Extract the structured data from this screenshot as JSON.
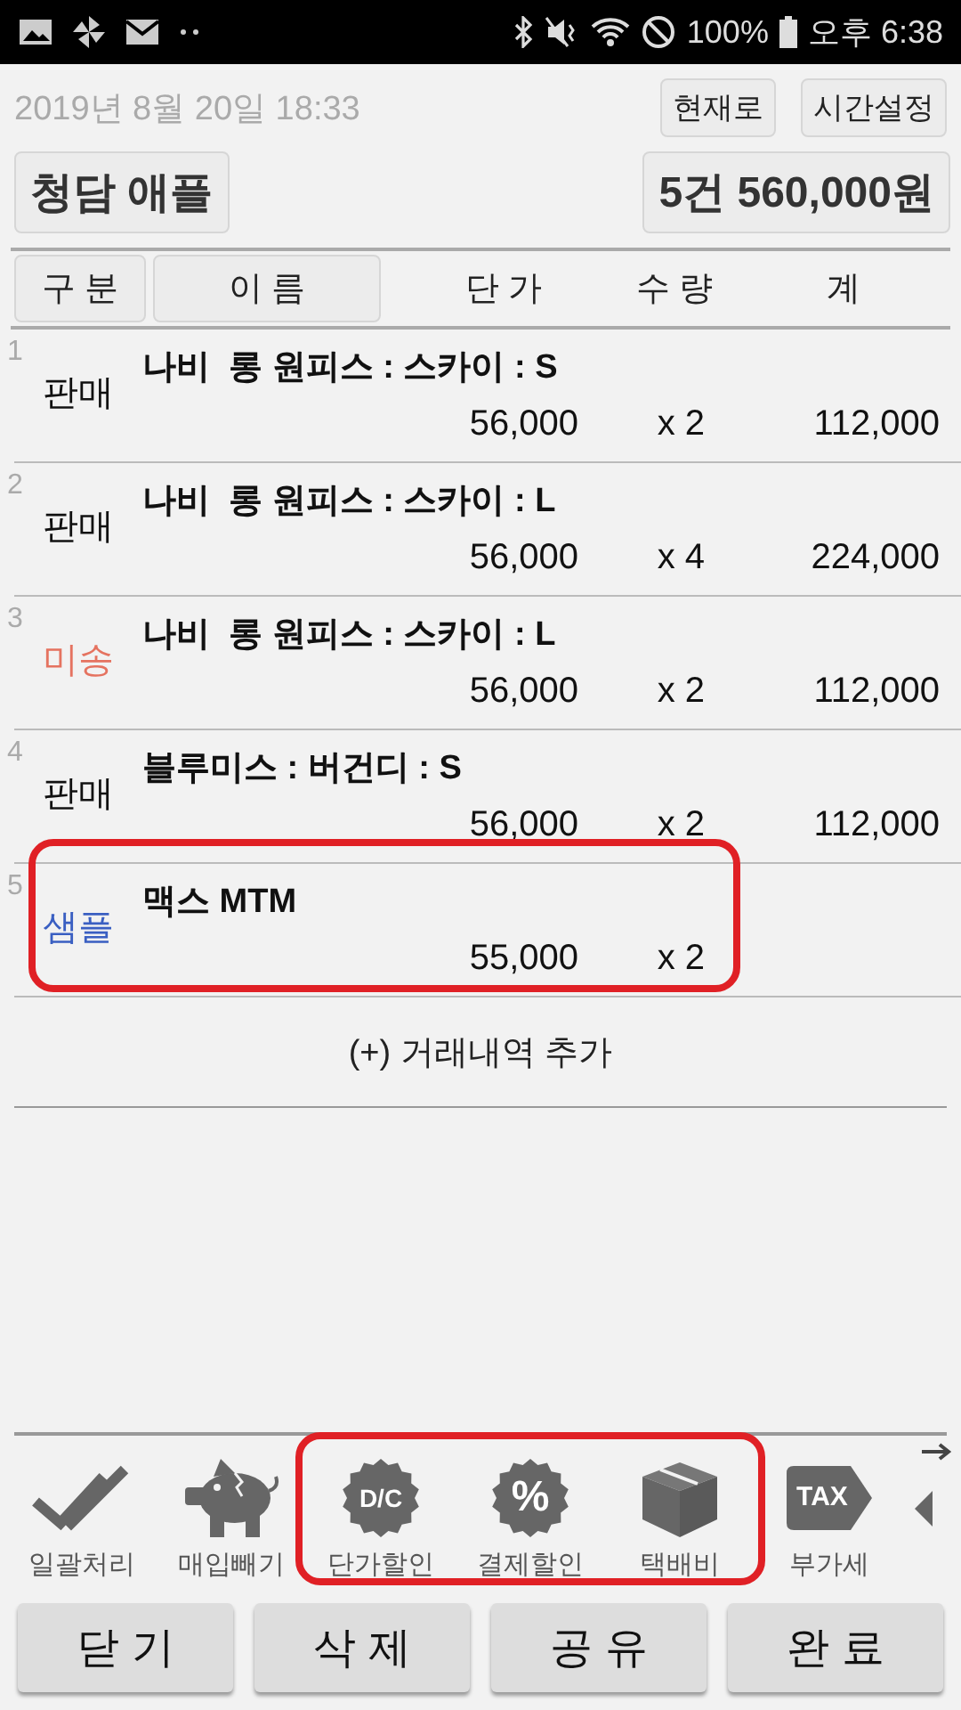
{
  "status_bar": {
    "battery": "100%",
    "time": "오후 6:38"
  },
  "header": {
    "datetime": "2019년 8월 20일 18:33",
    "buttons": [
      "현재로",
      "시간설정"
    ],
    "customer": "청담 애플",
    "summary": "5건 560,000원"
  },
  "columns": [
    {
      "label": "구 분",
      "kind": "button"
    },
    {
      "label": "이 름",
      "kind": "button"
    },
    {
      "label": "단 가",
      "kind": "plain"
    },
    {
      "label": "수 량",
      "kind": "plain"
    },
    {
      "label": "계",
      "kind": "plain"
    }
  ],
  "rows": [
    {
      "number": "1",
      "type": "판매",
      "kind": "sale",
      "name": "나비  롱 원피스 : 스카이 : S",
      "price": "56,000",
      "qty": "x 2",
      "total": "112,000",
      "highlighted": false
    },
    {
      "number": "2",
      "type": "판매",
      "kind": "sale",
      "name": "나비  롱 원피스 : 스카이 : L",
      "price": "56,000",
      "qty": "x 4",
      "total": "224,000",
      "highlighted": false
    },
    {
      "number": "3",
      "type": "미송",
      "kind": "pending",
      "name": "나비  롱 원피스 : 스카이 : L",
      "price": "56,000",
      "qty": "x 2",
      "total": "112,000",
      "highlighted": false
    },
    {
      "number": "4",
      "type": "판매",
      "kind": "sale",
      "name": "블루미스 : 버건디 : S",
      "price": "56,000",
      "qty": "x 2",
      "total": "112,000",
      "highlighted": false
    },
    {
      "number": "5",
      "type": "샘플",
      "kind": "sample",
      "name": "맥스 MTM",
      "price": "55,000",
      "qty": "x 2",
      "highlighted": true
    }
  ],
  "add_row": "(+) 거래내역 추가",
  "toolbar": [
    {
      "label": "일괄처리",
      "kind": "checks",
      "highlighted": false
    },
    {
      "label": "매입빼기",
      "kind": "piggy",
      "highlighted": false
    },
    {
      "label": "단가할인",
      "kind": "dc",
      "icon_text": "D/C",
      "highlighted": true
    },
    {
      "label": "결제할인",
      "kind": "percent",
      "icon_text": "%",
      "highlighted": true
    },
    {
      "label": "택배비",
      "kind": "box",
      "highlighted": true
    },
    {
      "label": "부가세",
      "kind": "tax",
      "icon_text": "TAX",
      "highlighted": false
    }
  ],
  "actions": [
    "닫 기",
    "삭 제",
    "공 유",
    "완 료"
  ]
}
